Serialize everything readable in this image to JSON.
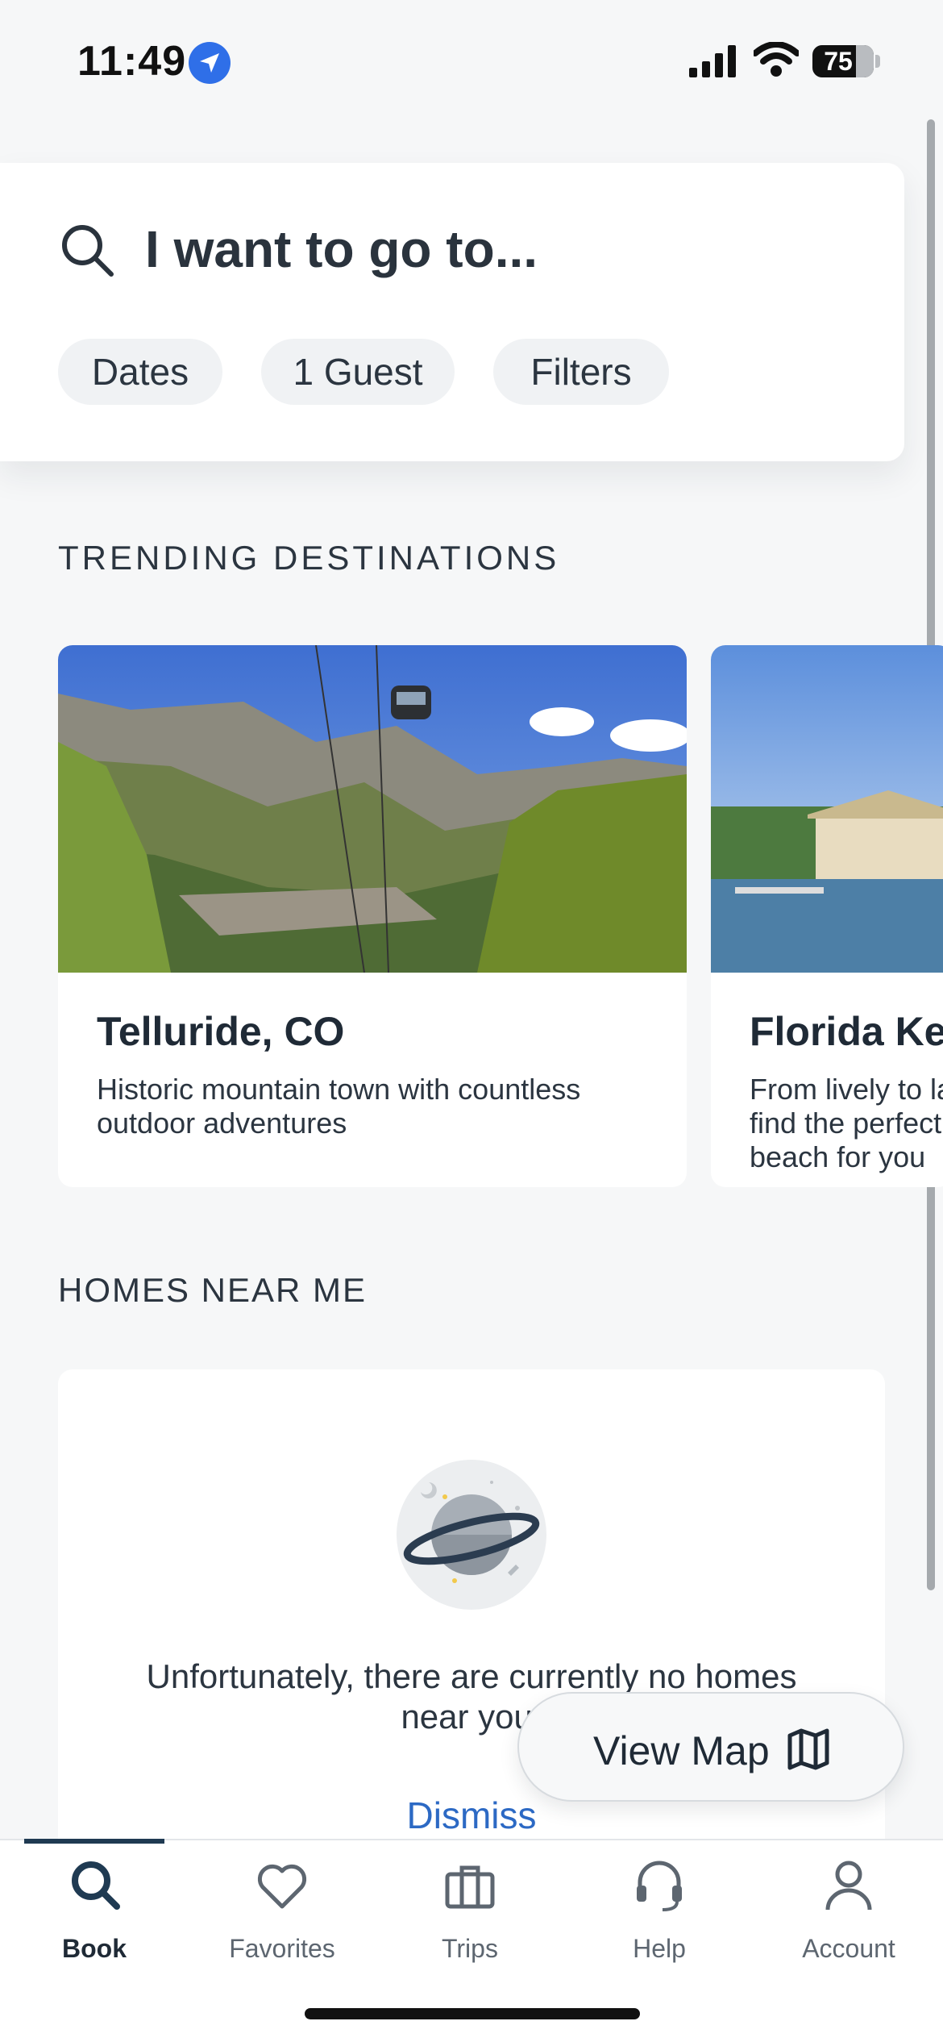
{
  "status_bar": {
    "time": "11:49",
    "battery": "75",
    "icons": [
      "location-arrow-icon",
      "cellular-signal-icon",
      "wifi-icon",
      "battery-icon"
    ]
  },
  "search": {
    "prompt": "I want to go to...",
    "chips": [
      "Dates",
      "1 Guest",
      "Filters"
    ]
  },
  "trending": {
    "title": "TRENDING DESTINATIONS",
    "destinations": [
      {
        "name": "Telluride, CO",
        "description": "Historic mountain town with countless outdoor adventures"
      },
      {
        "name": "Florida Keys",
        "description": "From lively to laid-back, find the perfect Keys beach for you"
      }
    ]
  },
  "homes_near_me": {
    "title": "HOMES NEAR ME",
    "empty_message": "Unfortunately, there are currently no homes near you.",
    "dismiss_label": "Dismiss"
  },
  "view_map": {
    "label": "View Map"
  },
  "tabs": [
    {
      "label": "Book",
      "icon": "search-icon",
      "active": true
    },
    {
      "label": "Favorites",
      "icon": "heart-icon",
      "active": false
    },
    {
      "label": "Trips",
      "icon": "briefcase-icon",
      "active": false
    },
    {
      "label": "Help",
      "icon": "headset-icon",
      "active": false
    },
    {
      "label": "Account",
      "icon": "person-icon",
      "active": false
    }
  ],
  "colors": {
    "background": "#f6f7f8",
    "accent_link": "#2c69c4",
    "location_dot": "#2f6fe8",
    "text_primary": "#1f2a36"
  }
}
